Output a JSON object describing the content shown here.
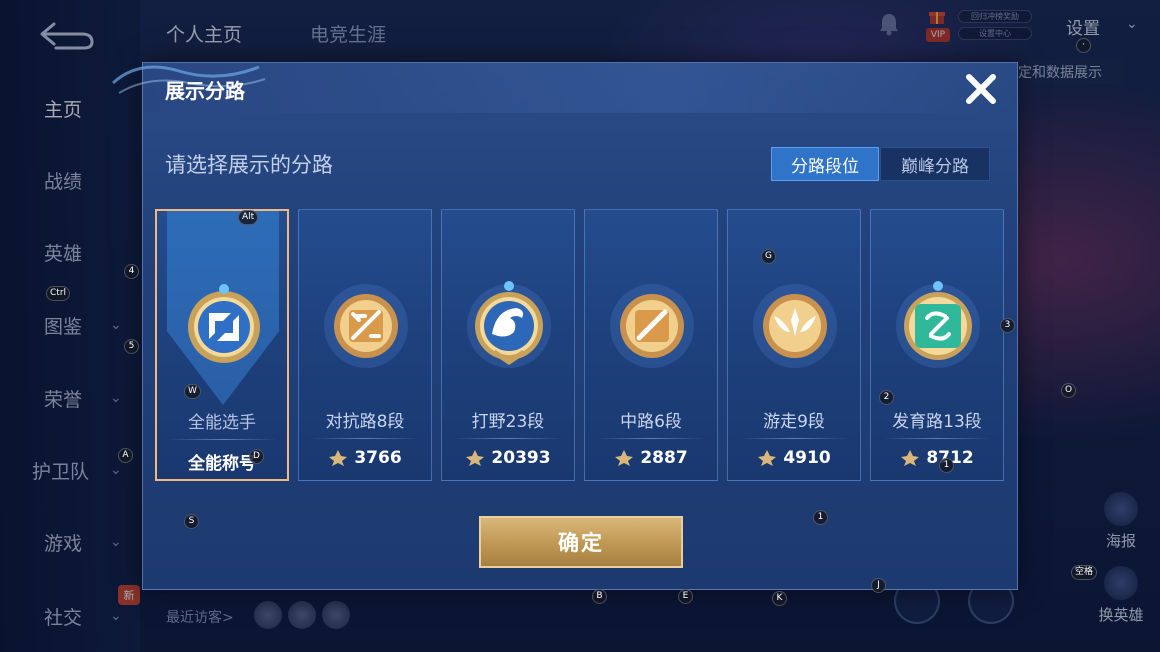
{
  "sidebar": {
    "items": [
      {
        "label": "主页",
        "active": true
      },
      {
        "label": "战绩",
        "active": false
      },
      {
        "label": "英雄",
        "active": false
      },
      {
        "label": "图鉴",
        "active": false,
        "chevron": true
      },
      {
        "label": "荣誉",
        "active": false,
        "chevron": true
      },
      {
        "label": "护卫队",
        "active": false,
        "chevron": true
      },
      {
        "label": "游戏",
        "active": false,
        "chevron": true
      },
      {
        "label": "社交",
        "active": false,
        "chevron": true
      }
    ],
    "new_badge": "新"
  },
  "top_tabs": [
    {
      "label": "个人主页"
    },
    {
      "label": "电竞生涯"
    }
  ],
  "top_right": {
    "vip": "VIP",
    "pill_1": "回归冲榜奖励",
    "pill_2": "设置中心",
    "settings": "设置",
    "peek_text": "定和数据展示"
  },
  "right_actions": [
    {
      "label": "海报"
    },
    {
      "label": "换英雄"
    }
  ],
  "visitors_label": "最近访客>",
  "modal": {
    "title": "展示分路",
    "prompt": "请选择展示的分路",
    "segments": [
      {
        "label": "分路段位",
        "selected": true
      },
      {
        "label": "巅峰分路",
        "selected": false
      }
    ],
    "cards": [
      {
        "label": "全能选手",
        "stat": "全能称号",
        "selected": true,
        "emblem": "allround-emblem-icon",
        "accent": "#3a7ad8"
      },
      {
        "label": "对抗路8段",
        "stat": "3766",
        "selected": false,
        "emblem": "clash-lane-emblem-icon",
        "accent": "#c98a4a"
      },
      {
        "label": "打野23段",
        "stat": "20393",
        "selected": false,
        "emblem": "jungle-emblem-icon",
        "accent": "#3a7ad8"
      },
      {
        "label": "中路6段",
        "stat": "2887",
        "selected": false,
        "emblem": "mid-lane-emblem-icon",
        "accent": "#c98a4a"
      },
      {
        "label": "游走9段",
        "stat": "4910",
        "selected": false,
        "emblem": "roam-emblem-icon",
        "accent": "#c98a4a"
      },
      {
        "label": "发育路13段",
        "stat": "8712",
        "selected": false,
        "emblem": "farm-lane-emblem-icon",
        "accent": "#2fb89a"
      }
    ],
    "confirm": "确定"
  },
  "key_hints": [
    "Alt",
    "4",
    "Ctrl",
    "5",
    "W",
    "A",
    "D",
    "S",
    "G",
    "3",
    "2",
    "O",
    "1",
    "1",
    "B",
    "E",
    "K",
    "J",
    "空格",
    "·"
  ],
  "colors": {
    "modal_bg": "#21407a",
    "selected_border": "#f0b980",
    "segment_active": "#2f74c8",
    "confirm_gold": "#c29a56"
  }
}
